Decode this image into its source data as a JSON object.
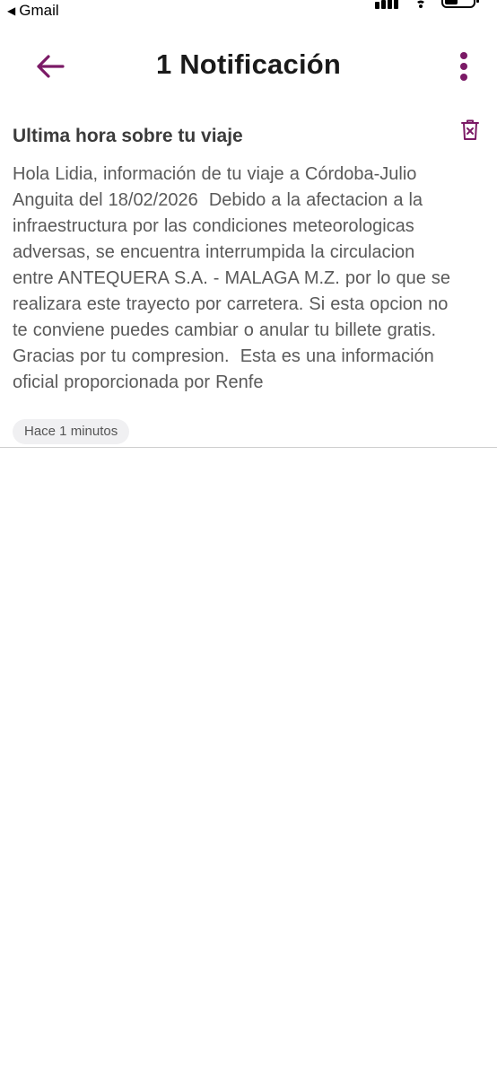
{
  "status_bar": {
    "back_app": "Gmail",
    "back_arrow": "◀"
  },
  "header": {
    "title": "1 Notificación",
    "back_icon": "arrow-left-icon",
    "more_icon": "more-vertical-icon"
  },
  "notification": {
    "title": "Ultima hora sobre tu viaje",
    "body": "Hola Lidia, información de tu viaje a Córdoba-Julio\nAnguita del 18/02/2026  Debido a la afectacion a la\ninfraestructura por las condiciones meteorologicas\nadversas, se encuentra interrumpida la circulacion\nentre ANTEQUERA S.A. - MALAGA M.Z. por lo que se\nrealizara este trayecto por carretera. Si esta opcion no\nte conviene puedes cambiar o anular tu billete gratis.\nGracias por tu compresion.  Esta es una información\noficial proporcionada por Renfe",
    "time": "Hace 1 minutos",
    "delete_icon": "trash-icon"
  },
  "colors": {
    "accent": "#7b1a66",
    "title_text": "#1a1a1a",
    "body_text": "#5a5a5a",
    "chip_bg": "#f0f0f2",
    "divider": "#cfcfcf"
  }
}
